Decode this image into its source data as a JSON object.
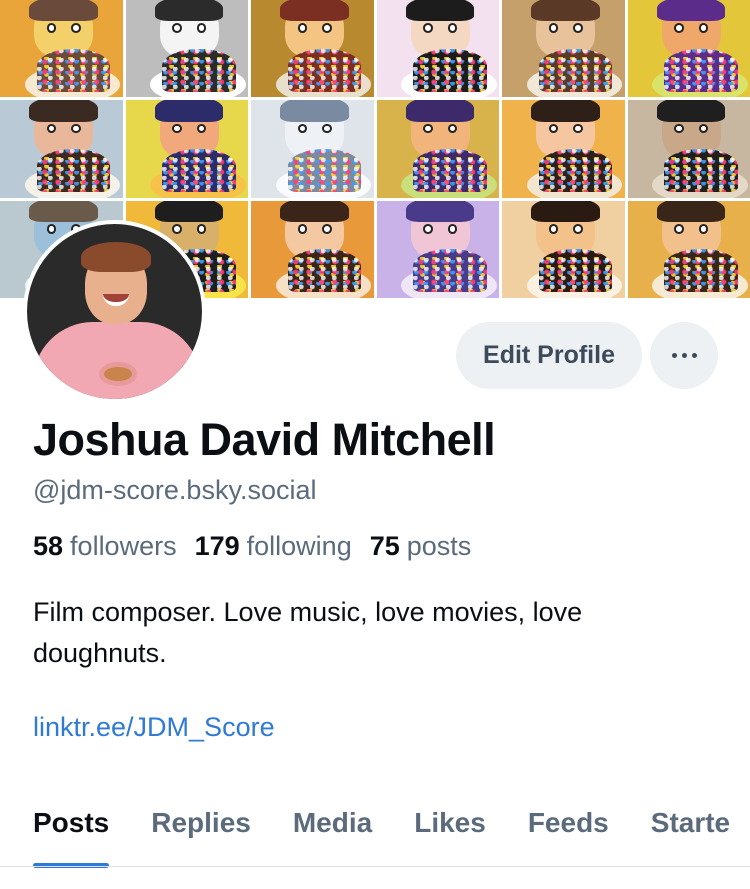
{
  "profile": {
    "display_name": "Joshua David Mitchell",
    "handle": "@jdm-score.bsky.social",
    "bio": "Film composer. Love music, love movies, love doughnuts.",
    "link": "linktr.ee/JDM_Score",
    "stats": [
      {
        "value": "58",
        "label": "followers"
      },
      {
        "value": "179",
        "label": "following"
      },
      {
        "value": "75",
        "label": "posts"
      }
    ]
  },
  "actions": {
    "edit_label": "Edit Profile",
    "more_icon": "ellipsis-horizontal-icon"
  },
  "tabs": [
    {
      "label": "Posts",
      "active": true
    },
    {
      "label": "Replies",
      "active": false
    },
    {
      "label": "Media",
      "active": false
    },
    {
      "label": "Likes",
      "active": false
    },
    {
      "label": "Feeds",
      "active": false
    },
    {
      "label": "Starte",
      "active": false
    }
  ],
  "colors": {
    "accent": "#2f7ad6",
    "text_primary": "#0b0f14",
    "text_secondary": "#5b6b7c",
    "button_bg": "#eef1f4"
  },
  "banner": {
    "tile_palettes": [
      [
        "#e9a53a",
        "#f3d06a",
        "#f6e9d0",
        "#6a4a3a"
      ],
      [
        "#bdbdbd",
        "#f4f4f4",
        "#ffffff",
        "#2b2b2b"
      ],
      [
        "#b8892f",
        "#f4c483",
        "#e9e0cc",
        "#7a2f22"
      ],
      [
        "#f3e1f0",
        "#f4d8c2",
        "#ffffff",
        "#1c1c1c"
      ],
      [
        "#c5a06a",
        "#e8c29a",
        "#f1e7d6",
        "#5a3a26"
      ],
      [
        "#e3c63a",
        "#f0a86a",
        "#d9e36a",
        "#5b2c8a"
      ],
      [
        "#b9c9d6",
        "#e9b89a",
        "#f4f1e8",
        "#3a2a22"
      ],
      [
        "#e6d84a",
        "#f1a87a",
        "#f6c24a",
        "#2c2c6a"
      ],
      [
        "#dfe3ea",
        "#eef2f7",
        "#f9fbff",
        "#7a8aa0"
      ],
      [
        "#d8b24a",
        "#f1b47a",
        "#c9e07a",
        "#3c2a6a"
      ],
      [
        "#f0b24a",
        "#f5c6a0",
        "#f3e6d0",
        "#2e2018"
      ],
      [
        "#c7b7a0",
        "#c9a88a",
        "#e3d9c6",
        "#1f1f1f"
      ],
      [
        "#b9c9cf",
        "#9cc0d9",
        "#e8f1f4",
        "#6a5a4a"
      ],
      [
        "#f1b93a",
        "#d8b06a",
        "#f6e44a",
        "#1e1e1e"
      ],
      [
        "#e89a3a",
        "#f4c8a0",
        "#f6e0c6",
        "#3b2418"
      ],
      [
        "#c9b2e8",
        "#f0c6d6",
        "#efe6f6",
        "#4a3a8a"
      ],
      [
        "#f0cfa0",
        "#f3c18a",
        "#faf1e2",
        "#2a1a12"
      ],
      [
        "#e8b04a",
        "#f2c08a",
        "#f7ead2",
        "#3a2618"
      ]
    ]
  }
}
